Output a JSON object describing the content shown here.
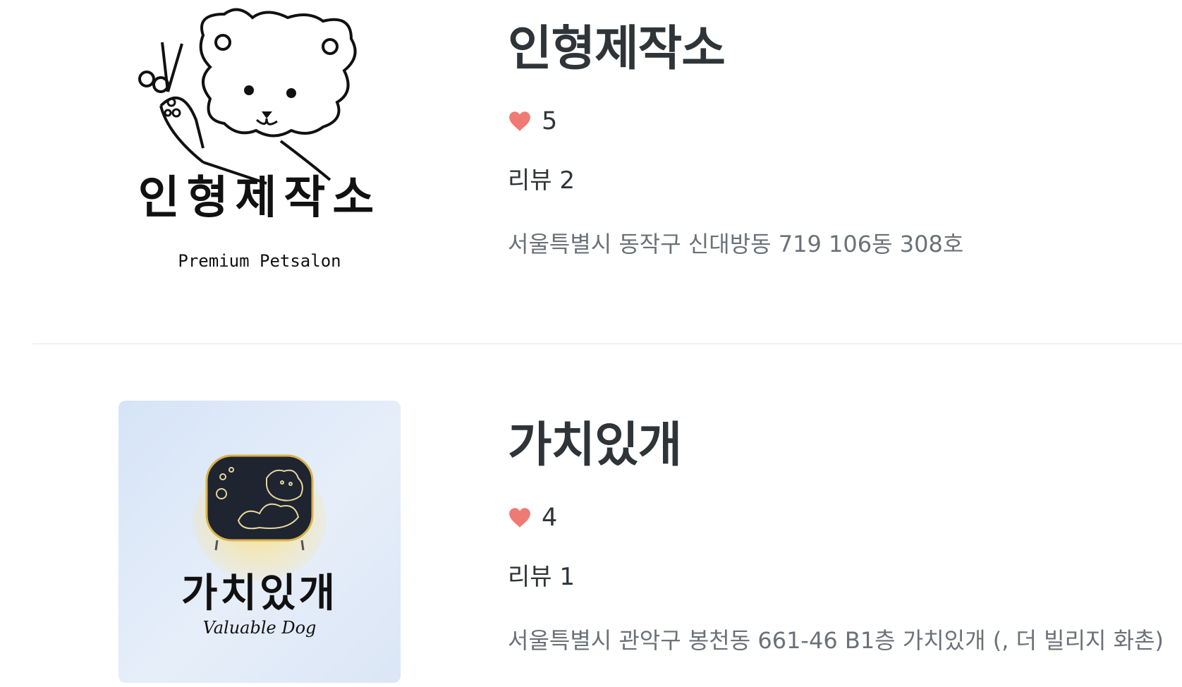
{
  "shops": [
    {
      "name": "인형제작소",
      "likes": "5",
      "reviews": "리뷰 2",
      "address": "서울특별시 동작구 신대방동 719 106동 308호",
      "logo_text": "인형제작소",
      "logo_subtitle": "Premium   Petsalon"
    },
    {
      "name": "가치있개",
      "likes": "4",
      "reviews": "리뷰 1",
      "address": "서울특별시 관악구 봉천동 661-46 B1층 가치있개 (, 더 빌리지 화촌)",
      "logo_text": "가치있개",
      "logo_subtitle": "Valuable Dog"
    }
  ],
  "colors": {
    "heart": "#ef7a74",
    "title": "#2f3438",
    "address": "#6b7178",
    "divider": "#e6e6e6"
  },
  "icons": {
    "like": "heart-icon"
  }
}
